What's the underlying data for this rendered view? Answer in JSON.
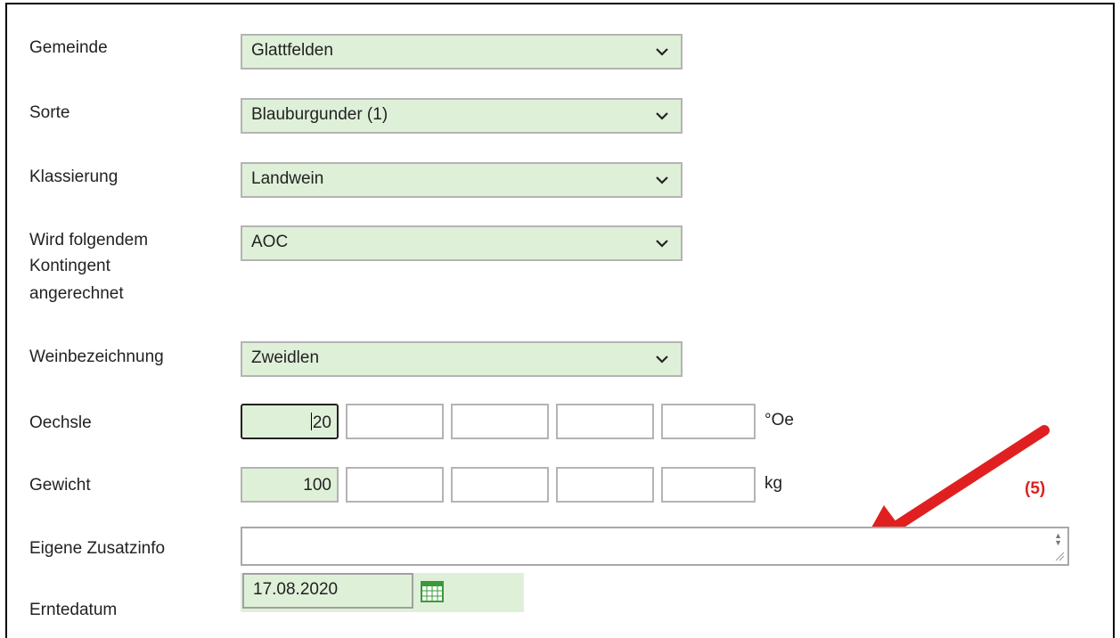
{
  "form": {
    "gemeinde": {
      "label": "Gemeinde",
      "value": "Glattfelden"
    },
    "sorte": {
      "label": "Sorte",
      "value": "Blauburgunder (1)"
    },
    "klassierung": {
      "label": "Klassierung",
      "value": "Landwein"
    },
    "kontingent": {
      "label_lines": [
        "Wird folgendem",
        "Kontingent",
        "angerechnet"
      ],
      "value": "AOC"
    },
    "weinbezeichnung": {
      "label": "Weinbezeichnung",
      "value": "Zweidlen"
    },
    "oechsle": {
      "label": "Oechsle",
      "values": [
        "20",
        "",
        "",
        "",
        ""
      ],
      "unit": "°Oe"
    },
    "gewicht": {
      "label": "Gewicht",
      "values": [
        "100",
        "",
        "",
        "",
        ""
      ],
      "unit": "kg"
    },
    "zusatzinfo": {
      "label": "Eigene Zusatzinfo",
      "value": ""
    },
    "erntedatum": {
      "label": "Erntedatum",
      "value": "17.08.2020"
    }
  },
  "annotation": {
    "label": "(5)",
    "color": "#e02020"
  },
  "colors": {
    "field_bg": "#dff0d8",
    "border": "#b4b4b4",
    "calendar": "#3a9a3a"
  }
}
